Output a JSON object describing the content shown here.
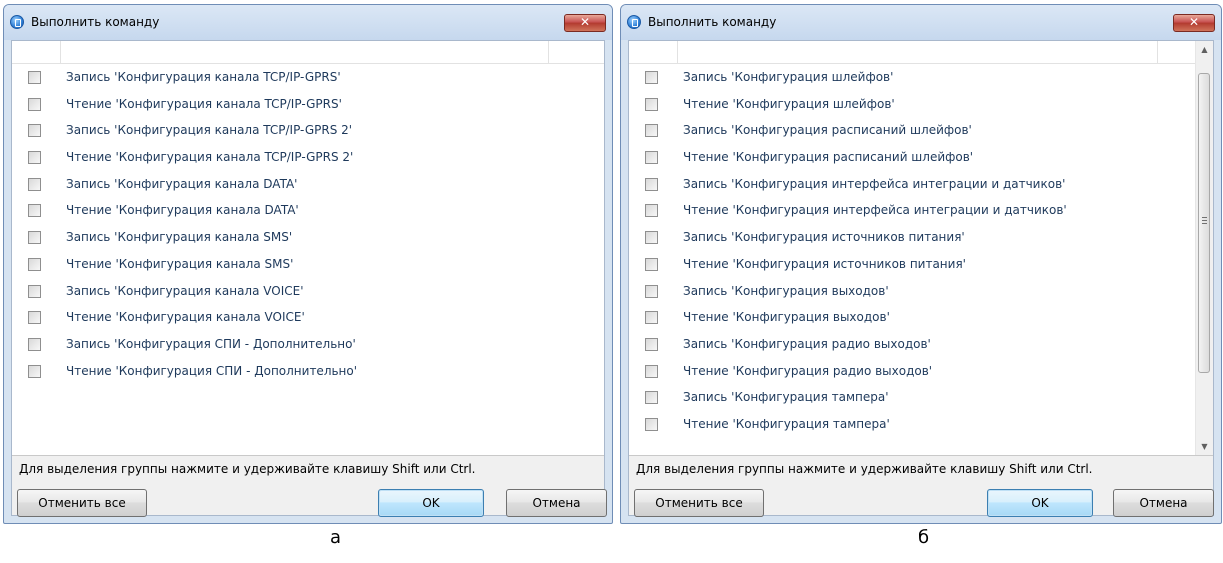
{
  "dialog_a": {
    "title": "Выполнить команду",
    "close_glyph": "✕",
    "items": [
      {
        "label": "Запись 'Конфигурация канала TCP/IP-GPRS'",
        "checked": false
      },
      {
        "label": "Чтение 'Конфигурация канала TCP/IP-GPRS'",
        "checked": false
      },
      {
        "label": "Запись 'Конфигурация канала TCP/IP-GPRS 2'",
        "checked": false
      },
      {
        "label": "Чтение 'Конфигурация канала TCP/IP-GPRS 2'",
        "checked": false
      },
      {
        "label": "Запись 'Конфигурация канала DATA'",
        "checked": false
      },
      {
        "label": "Чтение 'Конфигурация канала DATA'",
        "checked": false
      },
      {
        "label": "Запись 'Конфигурация канала SMS'",
        "checked": false
      },
      {
        "label": "Чтение 'Конфигурация канала SMS'",
        "checked": false
      },
      {
        "label": "Запись 'Конфигурация канала VOICE'",
        "checked": false
      },
      {
        "label": "Чтение 'Конфигурация канала VOICE'",
        "checked": false
      },
      {
        "label": "Запись 'Конфигурация СПИ - Дополнительно'",
        "checked": false
      },
      {
        "label": "Чтение 'Конфигурация СПИ - Дополнительно'",
        "checked": false
      }
    ],
    "hint": "Для выделения группы нажмите и удерживайте клавишу Shift или Ctrl.",
    "buttons": {
      "deselect_all": "Отменить все",
      "ok": "OK",
      "cancel": "Отмена"
    },
    "caption": "а"
  },
  "dialog_b": {
    "title": "Выполнить команду",
    "close_glyph": "✕",
    "items": [
      {
        "label": "Запись 'Конфигурация шлейфов'",
        "checked": false
      },
      {
        "label": "Чтение 'Конфигурация шлейфов'",
        "checked": false
      },
      {
        "label": "Запись 'Конфигурация расписаний шлейфов'",
        "checked": false
      },
      {
        "label": "Чтение 'Конфигурация расписаний шлейфов'",
        "checked": false
      },
      {
        "label": "Запись 'Конфигурация интерфейса интеграции и датчиков'",
        "checked": false
      },
      {
        "label": "Чтение 'Конфигурация интерфейса интеграции и датчиков'",
        "checked": false
      },
      {
        "label": "Запись 'Конфигурация источников питания'",
        "checked": false
      },
      {
        "label": "Чтение 'Конфигурация источников питания'",
        "checked": false
      },
      {
        "label": "Запись 'Конфигурация выходов'",
        "checked": false
      },
      {
        "label": "Чтение 'Конфигурация выходов'",
        "checked": false
      },
      {
        "label": "Запись 'Конфигурация радио выходов'",
        "checked": false
      },
      {
        "label": "Чтение 'Конфигурация радио выходов'",
        "checked": false
      },
      {
        "label": "Запись 'Конфигурация тампера'",
        "checked": false
      },
      {
        "label": "Чтение 'Конфигурация тампера'",
        "checked": false
      }
    ],
    "hint": "Для выделения группы нажмите и удерживайте клавишу Shift или Ctrl.",
    "buttons": {
      "deselect_all": "Отменить все",
      "ok": "OK",
      "cancel": "Отмена"
    },
    "scroll": {
      "up_glyph": "▲",
      "down_glyph": "▼"
    },
    "caption": "б"
  }
}
